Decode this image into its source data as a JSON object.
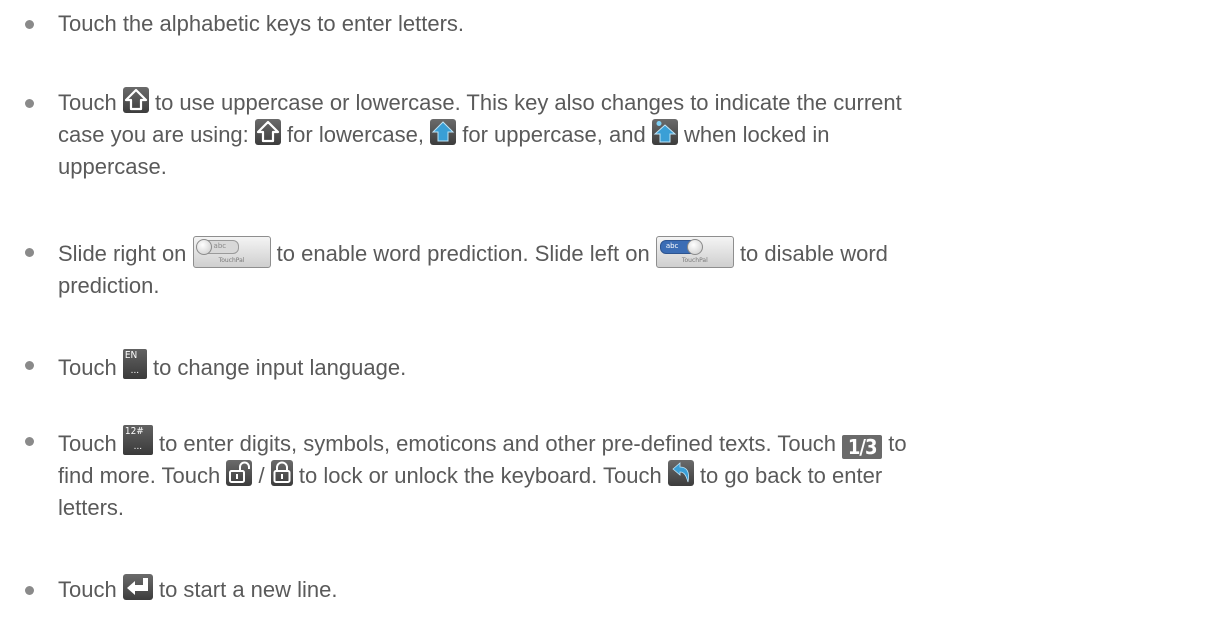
{
  "items": [
    {
      "text": "Touch the alphabetic keys to enter letters."
    },
    {
      "t1": "Touch",
      "t2": "to use uppercase or lowercase. This key also changes to indicate the current",
      "t3": "case you are using:",
      "t4": "for lowercase,",
      "t5": "for uppercase, and",
      "t6": "when locked in",
      "t7": "uppercase."
    },
    {
      "t1": "Slide right on",
      "t2": "to enable word prediction. Slide left on",
      "t3": "to disable word",
      "t4": "prediction."
    },
    {
      "t1": "Touch",
      "t2": "to change input language."
    },
    {
      "t1": "Touch",
      "t2": "to enter digits, symbols, emoticons and other pre-defined texts. Touch",
      "t3": "to",
      "t4": "find more. Touch",
      "t5": "/",
      "t6": "to lock or unlock the keyboard. Touch",
      "t7": "to go back to enter",
      "t8": "letters."
    },
    {
      "t1": "Touch",
      "t2": "to start a new line."
    }
  ],
  "icons": {
    "shift": "shift-outline-icon",
    "shift_upper": "shift-filled-icon",
    "shift_locked": "shift-locked-icon",
    "prediction_toggle": "word-prediction-toggle-icon",
    "language": "language-key-icon",
    "symbols": "symbols-key-icon",
    "lock_open": "unlocked-padlock-icon",
    "lock_closed": "locked-padlock-icon",
    "back": "back-arrow-icon",
    "enter": "enter-key-icon"
  },
  "key_text": {
    "pred_abc": "abc",
    "pred_brand": "TouchPal",
    "lang_code": "EN",
    "symbols_code": "12#",
    "key_dots": "...",
    "page": "1/3"
  },
  "colors": {
    "text": "#5a5a5a",
    "bullet": "#8a8a8a",
    "arrow_blue": "#3a9fd6"
  }
}
